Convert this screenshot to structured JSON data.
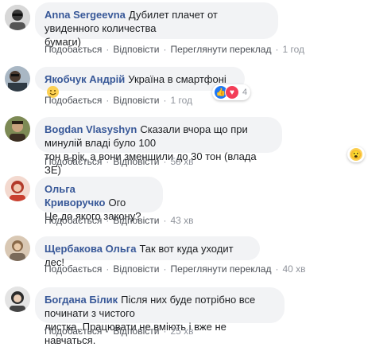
{
  "comments": [
    {
      "author": "Anna Sergeevna",
      "text_line1": "Дубилет плачет от увиденного количества",
      "text_line2": "бумаги)",
      "like": "Подобається",
      "reply": "Відповісти",
      "translate": "Переглянути переклад",
      "time": "1 год"
    },
    {
      "author": "Якобчук Андрій",
      "text_line1": "Україна в смартфоні",
      "emoji": "smile-emoji",
      "like": "Подобається",
      "reply": "Відповісти",
      "time": "1 год",
      "reaction_count": "4",
      "reactions": [
        "like",
        "love"
      ]
    },
    {
      "author": "Bogdan Vlasyshyn",
      "text_line1": "Сказали вчора що при минулій владі було 100",
      "text_line2": "тон в рік, а вони зменшили до 30 тон (влада ЗЕ)",
      "like": "Подобається",
      "reply": "Відповісти",
      "time": "58 хв",
      "reactions": [
        "wow"
      ]
    },
    {
      "author": "Ольга Криворучко",
      "text_line1": "Ого",
      "text_line2": "Це до якого закону?",
      "like": "Подобається",
      "reply": "Відповісти",
      "time": "43 хв"
    },
    {
      "author": "Щербакова Ольга",
      "text_line1": "Так вот куда уходит лес!",
      "like": "Подобається",
      "reply": "Відповісти",
      "translate": "Переглянути переклад",
      "time": "40 хв"
    },
    {
      "author": "Богдана Білик",
      "text_line1": "Після них буде потрібно все починати з чистого",
      "text_line2": "листка. Працювати не вміють і вже не навчаться.",
      "like": "Подобається",
      "reply": "Відповісти",
      "time": "25 хв"
    }
  ],
  "separator": "·",
  "colors": {
    "author": "#385898",
    "bubble": "#f2f3f5",
    "meta": "#90949c",
    "like_reaction": "#2078f4",
    "love_reaction": "#f33e58",
    "wow_reaction": "#fcd052"
  }
}
